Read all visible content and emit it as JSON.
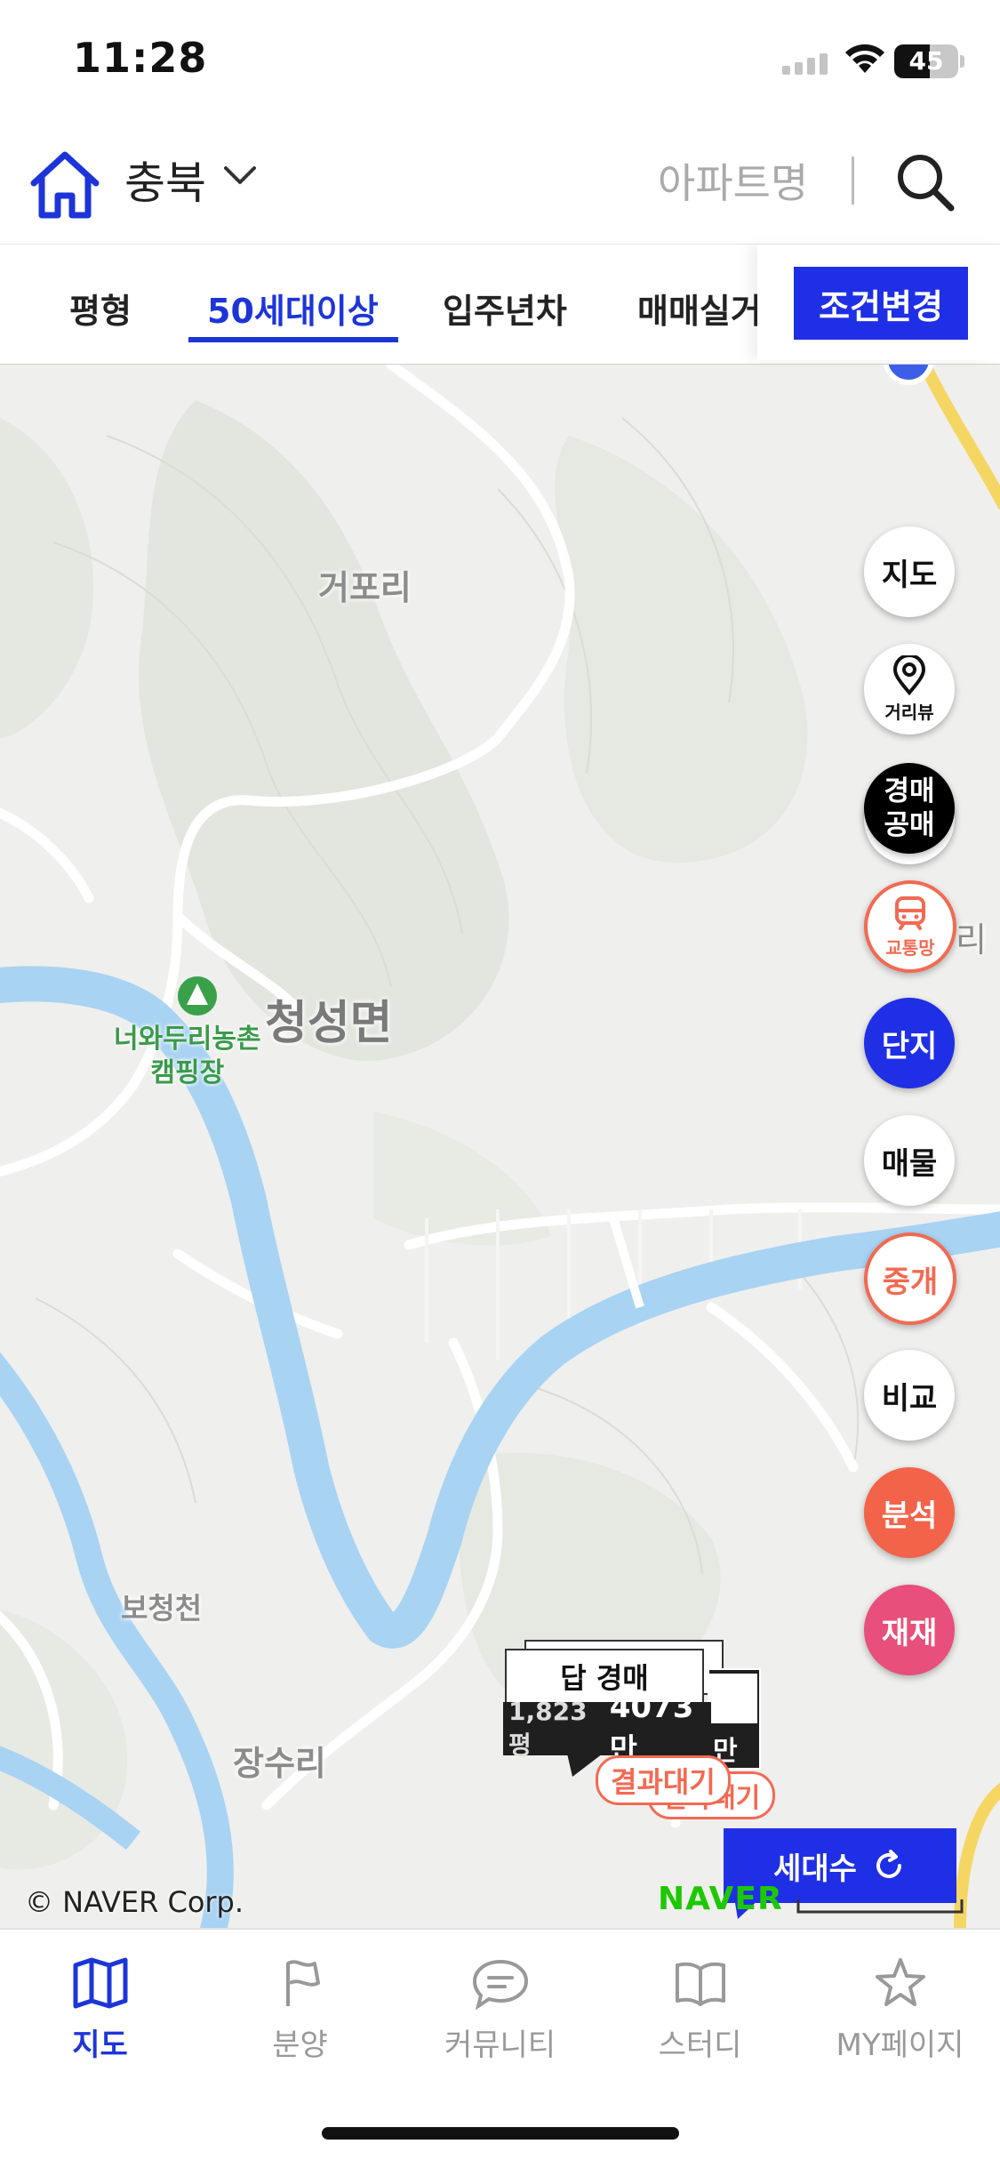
{
  "status_bar": {
    "time": "11:28",
    "battery": "45"
  },
  "header": {
    "region": "충북",
    "search_placeholder": "아파트명"
  },
  "filters": {
    "tabs": [
      "평형",
      "50세대이상",
      "입주년차",
      "매매실거"
    ],
    "active_tab": "50세대이상",
    "change_button": "조건변경"
  },
  "map": {
    "labels": {
      "village_1": "거포리",
      "myeon": "청성면",
      "camping": "너와두리농촌\n캠핑장",
      "stream": "보청천",
      "village_2": "장수리",
      "edge": "리"
    },
    "side_buttons": {
      "map": "지도",
      "street_view": "거리뷰",
      "auction": "경매\n공매",
      "transit": "교통망",
      "complex": "단지",
      "listing": "매물",
      "broker": "중개",
      "compare": "비교",
      "analysis": "분석",
      "rebuild": "재재"
    },
    "marker": {
      "type": "답 경매",
      "area": "1,823평",
      "price": "4073만",
      "back_price_suffix": "만",
      "status": "결과대기",
      "status_back": "결과대기"
    },
    "units_button": "세대수",
    "copyright": "© NAVER Corp.",
    "logo_text": "NAVER"
  },
  "bottom_nav": [
    {
      "label": "지도",
      "icon": "map-icon",
      "active": true
    },
    {
      "label": "분양",
      "icon": "flag-icon",
      "active": false
    },
    {
      "label": "커뮤니티",
      "icon": "chat-icon",
      "active": false
    },
    {
      "label": "스터디",
      "icon": "book-icon",
      "active": false
    },
    {
      "label": "MY페이지",
      "icon": "star-icon",
      "active": false
    }
  ],
  "colors": {
    "accent": "#1f2fe6",
    "river": "#a8d3f3",
    "orange": "#f26a52",
    "pink": "#e84f7a",
    "map_bg": "#efefed"
  }
}
